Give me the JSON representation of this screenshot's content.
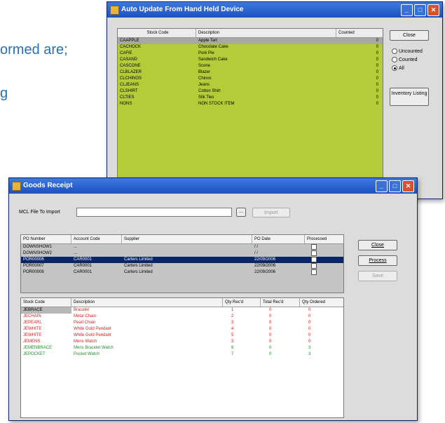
{
  "background": {
    "line1": "ormed are;",
    "line2": "g"
  },
  "auto_update": {
    "title": "Auto Update From Hand Held Device",
    "columns": [
      "Stock Code",
      "Description",
      "Counted"
    ],
    "rows": [
      [
        "CAAPPLE",
        "Apple Tart",
        "0"
      ],
      [
        "CACHOCK",
        "Chocolate Cake",
        "0"
      ],
      [
        "CAFIE",
        "Pork Pie",
        "0"
      ],
      [
        "CASAND",
        "Sandwich Cake",
        "0"
      ],
      [
        "CASCONE",
        "Scone",
        "0"
      ],
      [
        "CLBLAZER",
        "Blazer",
        "0"
      ],
      [
        "CLCHINOS",
        "Chinos",
        "0"
      ],
      [
        "CLJEANS",
        "Jeans",
        "0"
      ],
      [
        "CLSHIRT",
        "Cotton Shirt",
        "0"
      ],
      [
        "CLTIES",
        "Silk Ties",
        "0"
      ],
      [
        "NONS",
        "NON STOCK ITEM",
        "0"
      ]
    ],
    "close_label": "Close",
    "radio_uncounted": "Uncounted",
    "radio_counted": "Counted",
    "radio_all": "All",
    "inventory_label": "Inventory Listing",
    "colors": {
      "grid_bg": "#b4cc38",
      "selected_row": "#a8a8a8"
    }
  },
  "goods_receipt": {
    "title": "Goods Receipt",
    "file_label": "MCL File To Import",
    "file_value": "",
    "browse_label": "...",
    "import_label": "Import",
    "po_columns": [
      "PO Number",
      "Account Code",
      "Supplier",
      "PO Date",
      "Processed"
    ],
    "po_rows": [
      [
        "DOWNSHOW1",
        "...",
        "",
        "/ /",
        ""
      ],
      [
        "DOWNSHOW2",
        "...",
        "",
        "/ /",
        ""
      ],
      [
        "POR00006",
        "CAR0001",
        "Carters Limited",
        "22/09/2006",
        ""
      ],
      [
        "POR00007",
        "CAR0001",
        "Carters Limited",
        "22/09/2006",
        ""
      ],
      [
        "POR00008",
        "CAR0001",
        "Carters Limited",
        "22/09/2006",
        ""
      ]
    ],
    "close_label": "Close",
    "process_label": "Process",
    "save_label": "Save",
    "item_columns": [
      "Stock Code",
      "Description",
      "Qty Rec'd",
      "Total Rec'd",
      "Qty Ordered"
    ],
    "item_rows": [
      [
        "JEBRACE",
        "Bracelet",
        "1",
        "0",
        "0"
      ],
      [
        "JECHAIN",
        "Metal Chain",
        "2",
        "0",
        "0"
      ],
      [
        "JEPEARL",
        "Pearl Chain",
        "3",
        "0",
        "0"
      ],
      [
        "JEWHITE",
        "White Gold Pendant",
        "4",
        "0",
        "0"
      ],
      [
        "JEWHITE",
        "White Gold Pendant",
        "5",
        "0",
        "0"
      ],
      [
        "JEMENS",
        "Mens Watch",
        "3",
        "0",
        "0"
      ],
      [
        "JEMENBRACE",
        "Mens Bracelet Watch",
        "6",
        "0",
        "3"
      ],
      [
        "JEPOCKET",
        "Pocket Watch",
        "7",
        "0",
        "3"
      ]
    ],
    "item_colors": [
      "#d42020",
      "#d42020",
      "#d42020",
      "#d42020",
      "#d42020",
      "#d42020",
      "#1f8a2a",
      "#1f8a2a"
    ]
  }
}
